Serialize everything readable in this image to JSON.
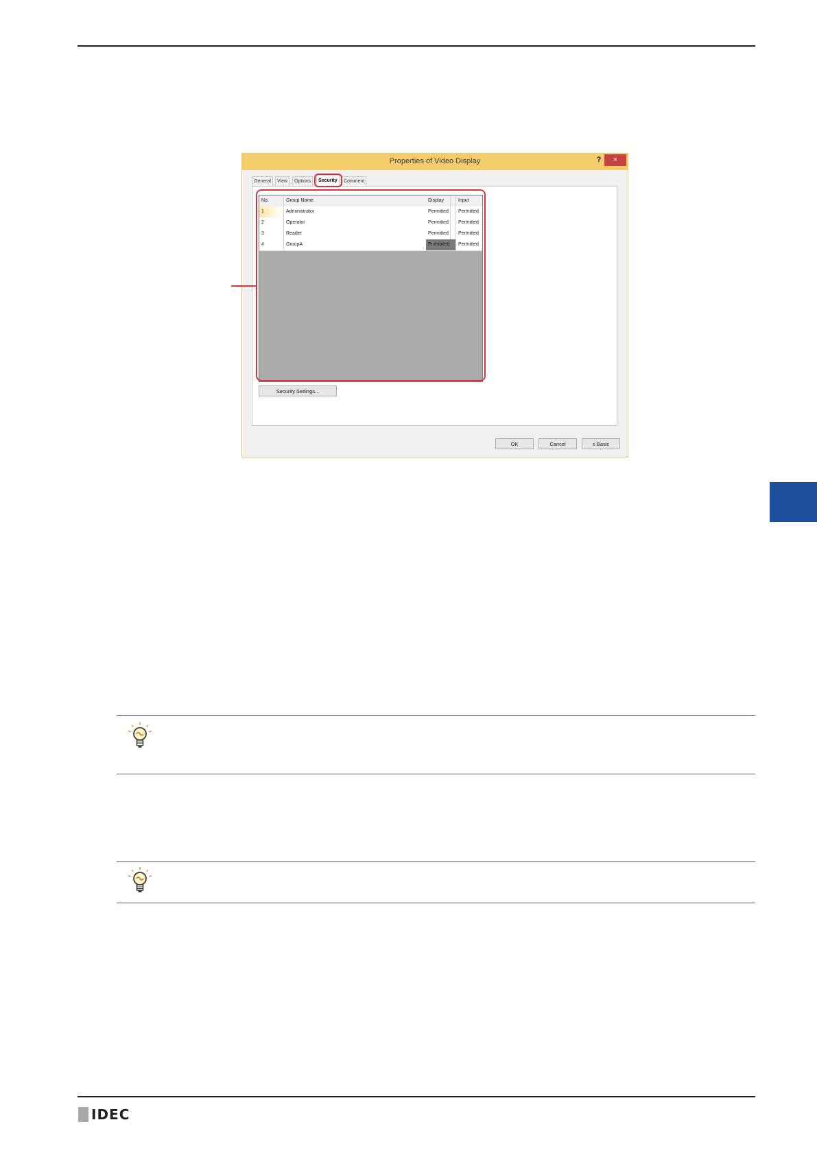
{
  "dialog": {
    "title": "Properties of Video Display",
    "help_label": "?",
    "close_label": "×",
    "tabs": [
      "General",
      "View",
      "Options",
      "Security",
      "Comment"
    ],
    "active_tab": "Security",
    "table": {
      "headers": [
        "No.",
        "Group Name",
        "Display",
        "Input"
      ],
      "rows": [
        {
          "no": "1",
          "name": "Administrator",
          "display": "Permitted",
          "input": "Permitted"
        },
        {
          "no": "2",
          "name": "Operator",
          "display": "Permitted",
          "input": "Permitted"
        },
        {
          "no": "3",
          "name": "Reader",
          "display": "Permitted",
          "input": "Permitted"
        },
        {
          "no": "4",
          "name": "GroupA",
          "display": "Prohibited",
          "input": "Permitted"
        }
      ]
    },
    "security_settings_button": "Security Settings...",
    "ok_button": "OK",
    "cancel_button": "Cancel",
    "basic_button": "≤ Basic"
  },
  "footer": {
    "logo_text": "IDEC"
  },
  "colors": {
    "highlight": "#d6343c",
    "side_tab": "#1d4f9e",
    "titlebar": "#f4cc6a"
  },
  "icons": [
    "lightbulb-icon",
    "lightbulb-icon"
  ]
}
